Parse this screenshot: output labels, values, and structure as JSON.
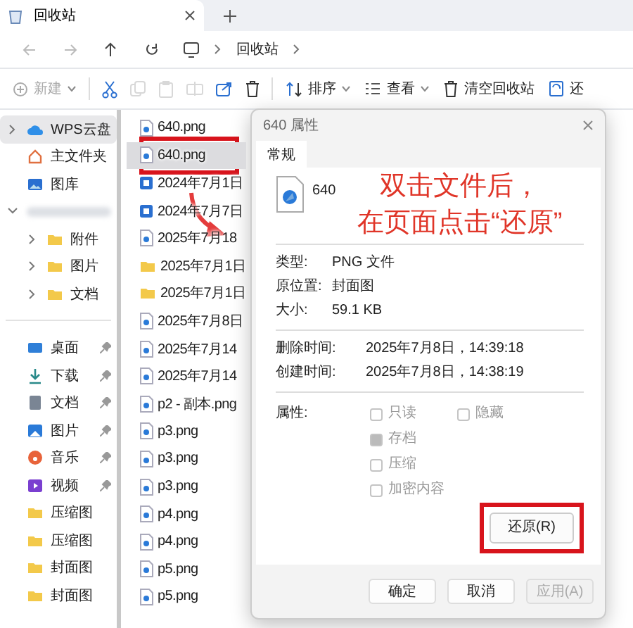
{
  "tabs": [
    {
      "title": "回收站",
      "selected": true
    }
  ],
  "address": {
    "path": [
      "回收站"
    ]
  },
  "toolbar": [
    [
      {
        "kind": "new",
        "label": "新建",
        "dropdown": true,
        "disabled": true
      }
    ],
    [
      {
        "kind": "cut",
        "dropdown": false,
        "disabled": false
      },
      {
        "kind": "copy",
        "dropdown": false,
        "disabled": true
      },
      {
        "kind": "paste",
        "dropdown": false,
        "disabled": true
      },
      {
        "kind": "rename",
        "dropdown": false,
        "disabled": true
      },
      {
        "kind": "share",
        "dropdown": false,
        "disabled": false
      },
      {
        "kind": "delete",
        "dropdown": false,
        "disabled": false
      }
    ],
    [
      {
        "kind": "sort",
        "label": "排序",
        "dropdown": true,
        "disabled": false
      },
      {
        "kind": "view",
        "label": "查看",
        "dropdown": true,
        "disabled": false
      },
      {
        "kind": "empty",
        "label": "清空回收站",
        "dropdown": false,
        "disabled": false
      },
      {
        "kind": "restore",
        "label": "还",
        "dropdown": false,
        "disabled": false
      }
    ]
  ],
  "sidebar": {
    "sections": [
      {
        "items": [
          {
            "kind": "cloud",
            "label": "WPS云盘",
            "selected": true,
            "expandable": true,
            "expanded": false,
            "pinned": false
          },
          {
            "kind": "home",
            "label": "主文件夹",
            "selected": false,
            "expandable": false,
            "pinned": false
          },
          {
            "kind": "gallery",
            "label": "图库",
            "selected": false,
            "expandable": false,
            "pinned": false
          },
          {
            "kind": "blurred",
            "selected": false,
            "expandable": true,
            "expanded": true,
            "pinned": false,
            "children": [
              {
                "kind": "folder",
                "label": "附件",
                "selected": false,
                "expandable": true,
                "expanded": false,
                "pinned": false
              },
              {
                "kind": "folder",
                "label": "图片",
                "selected": false,
                "expandable": true,
                "expanded": false,
                "pinned": false
              },
              {
                "kind": "folder",
                "label": "文档",
                "selected": false,
                "expandable": true,
                "expanded": false,
                "pinned": false
              }
            ]
          }
        ]
      },
      {
        "items": [
          {
            "kind": "desktop",
            "label": "桌面",
            "selected": false,
            "expandable": false,
            "pinned": true
          },
          {
            "kind": "download",
            "label": "下载",
            "selected": false,
            "expandable": false,
            "pinned": true
          },
          {
            "kind": "document",
            "label": "文档",
            "selected": false,
            "expandable": false,
            "pinned": true
          },
          {
            "kind": "pictures",
            "label": "图片",
            "selected": false,
            "expandable": false,
            "pinned": true
          },
          {
            "kind": "music",
            "label": "音乐",
            "selected": false,
            "expandable": false,
            "pinned": true
          },
          {
            "kind": "video",
            "label": "视频",
            "selected": false,
            "expandable": false,
            "pinned": true
          },
          {
            "kind": "folder",
            "label": "压缩图",
            "selected": false,
            "expandable": false,
            "pinned": false
          },
          {
            "kind": "folder",
            "label": "压缩图",
            "selected": false,
            "expandable": false,
            "pinned": false
          },
          {
            "kind": "folder",
            "label": "封面图",
            "selected": false,
            "expandable": false,
            "pinned": false
          },
          {
            "kind": "folder",
            "label": "封面图",
            "selected": false,
            "expandable": false,
            "pinned": false
          }
        ]
      }
    ]
  },
  "files": [
    {
      "kind": "image",
      "name": "640.png",
      "selected": false
    },
    {
      "kind": "image",
      "name": "640.png",
      "selected": true
    },
    {
      "kind": "tile",
      "name": "2024年7月1日",
      "selected": false
    },
    {
      "kind": "tile",
      "name": "2024年7月7日",
      "selected": false
    },
    {
      "kind": "image",
      "name": "2025年7月18",
      "selected": false
    },
    {
      "kind": "folder",
      "name": "2025年7月1日",
      "selected": false
    },
    {
      "kind": "folder",
      "name": "2025年7月1日",
      "selected": false
    },
    {
      "kind": "image",
      "name": "2025年7月8日",
      "selected": false
    },
    {
      "kind": "image",
      "name": "2025年7月14",
      "selected": false
    },
    {
      "kind": "image",
      "name": "2025年7月14",
      "selected": false
    },
    {
      "kind": "image",
      "name": "p2 - 副本.png",
      "selected": false
    },
    {
      "kind": "image",
      "name": "p3.png",
      "selected": false
    },
    {
      "kind": "image",
      "name": "p3.png",
      "selected": false
    },
    {
      "kind": "image",
      "name": "p3.png",
      "selected": false
    },
    {
      "kind": "image",
      "name": "p4.png",
      "selected": false
    },
    {
      "kind": "image",
      "name": "p4.png",
      "selected": false
    },
    {
      "kind": "image",
      "name": "p5.png",
      "selected": false
    },
    {
      "kind": "image",
      "name": "p5.png",
      "selected": false
    }
  ],
  "dialog": {
    "title": "640 属性",
    "tabs": [
      {
        "label": "常规",
        "selected": true
      }
    ],
    "file_name": "640",
    "note_lines": [
      "双击文件后，",
      "在页面点击“还原”"
    ],
    "details": [
      {
        "label": "类型:",
        "value": "PNG 文件"
      },
      {
        "label": "原位置:",
        "value": "封面图"
      },
      {
        "label": "大小:",
        "value": "59.1 KB"
      }
    ],
    "times": [
      {
        "label": "删除时间:",
        "value": "2025年7月8日，14:39:18"
      },
      {
        "label": "创建时间:",
        "value": "2025年7月8日，14:38:19"
      }
    ],
    "attributes_label": "属性:",
    "attributes": [
      {
        "label": "只读",
        "checked": false,
        "disabled": true
      },
      {
        "label": "隐藏",
        "checked": false,
        "disabled": true
      },
      {
        "label": "存档",
        "checked": true,
        "disabled": true
      },
      {
        "label": "压缩",
        "checked": false,
        "disabled": true
      },
      {
        "label": "加密内容",
        "checked": false,
        "disabled": true
      }
    ],
    "restore_button": "还原(R)",
    "buttons": [
      {
        "label": "确定",
        "disabled": false
      },
      {
        "label": "取消",
        "disabled": false
      },
      {
        "label": "应用(A)",
        "disabled": true
      }
    ]
  }
}
